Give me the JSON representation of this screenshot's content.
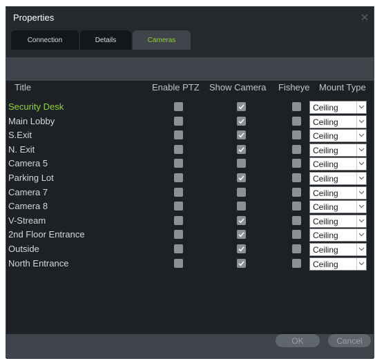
{
  "window": {
    "title": "Properties"
  },
  "tabs": [
    {
      "label": "Connection",
      "active": false
    },
    {
      "label": "Details",
      "active": false
    },
    {
      "label": "Cameras",
      "active": true
    }
  ],
  "columns": {
    "title": "Title",
    "enable_ptz": "Enable PTZ",
    "show_camera": "Show Camera",
    "fisheye": "Fisheye",
    "mount_type": "Mount Type"
  },
  "rows": [
    {
      "title": "Security Desk",
      "enable_ptz": false,
      "show_camera": true,
      "fisheye": false,
      "mount_type": "Ceiling",
      "selected": true
    },
    {
      "title": "Main Lobby",
      "enable_ptz": false,
      "show_camera": true,
      "fisheye": false,
      "mount_type": "Ceiling",
      "selected": false
    },
    {
      "title": "S.Exit",
      "enable_ptz": false,
      "show_camera": true,
      "fisheye": false,
      "mount_type": "Ceiling",
      "selected": false
    },
    {
      "title": "N. Exit",
      "enable_ptz": false,
      "show_camera": true,
      "fisheye": false,
      "mount_type": "Ceiling",
      "selected": false
    },
    {
      "title": "Camera 5",
      "enable_ptz": false,
      "show_camera": false,
      "fisheye": false,
      "mount_type": "Ceiling",
      "selected": false
    },
    {
      "title": "Parking Lot",
      "enable_ptz": false,
      "show_camera": true,
      "fisheye": false,
      "mount_type": "Ceiling",
      "selected": false
    },
    {
      "title": "Camera 7",
      "enable_ptz": false,
      "show_camera": false,
      "fisheye": false,
      "mount_type": "Ceiling",
      "selected": false
    },
    {
      "title": "Camera 8",
      "enable_ptz": false,
      "show_camera": false,
      "fisheye": false,
      "mount_type": "Ceiling",
      "selected": false
    },
    {
      "title": "V-Stream",
      "enable_ptz": false,
      "show_camera": true,
      "fisheye": false,
      "mount_type": "Ceiling",
      "selected": false
    },
    {
      "title": "2nd Floor Entrance",
      "enable_ptz": false,
      "show_camera": true,
      "fisheye": false,
      "mount_type": "Ceiling",
      "selected": false
    },
    {
      "title": "Outside",
      "enable_ptz": false,
      "show_camera": true,
      "fisheye": false,
      "mount_type": "Ceiling",
      "selected": false
    },
    {
      "title": "North Entrance",
      "enable_ptz": false,
      "show_camera": true,
      "fisheye": false,
      "mount_type": "Ceiling",
      "selected": false
    }
  ],
  "footer": {
    "ok_label": "OK",
    "cancel_label": "Cancel"
  },
  "colors": {
    "accent": "#8fd629",
    "background": "#1d2125",
    "panel": "#3e4449",
    "checkbox": "#8b9196"
  },
  "icons": {
    "close": "close-icon",
    "check": "check-icon",
    "dropdown": "chevron-down-icon"
  }
}
